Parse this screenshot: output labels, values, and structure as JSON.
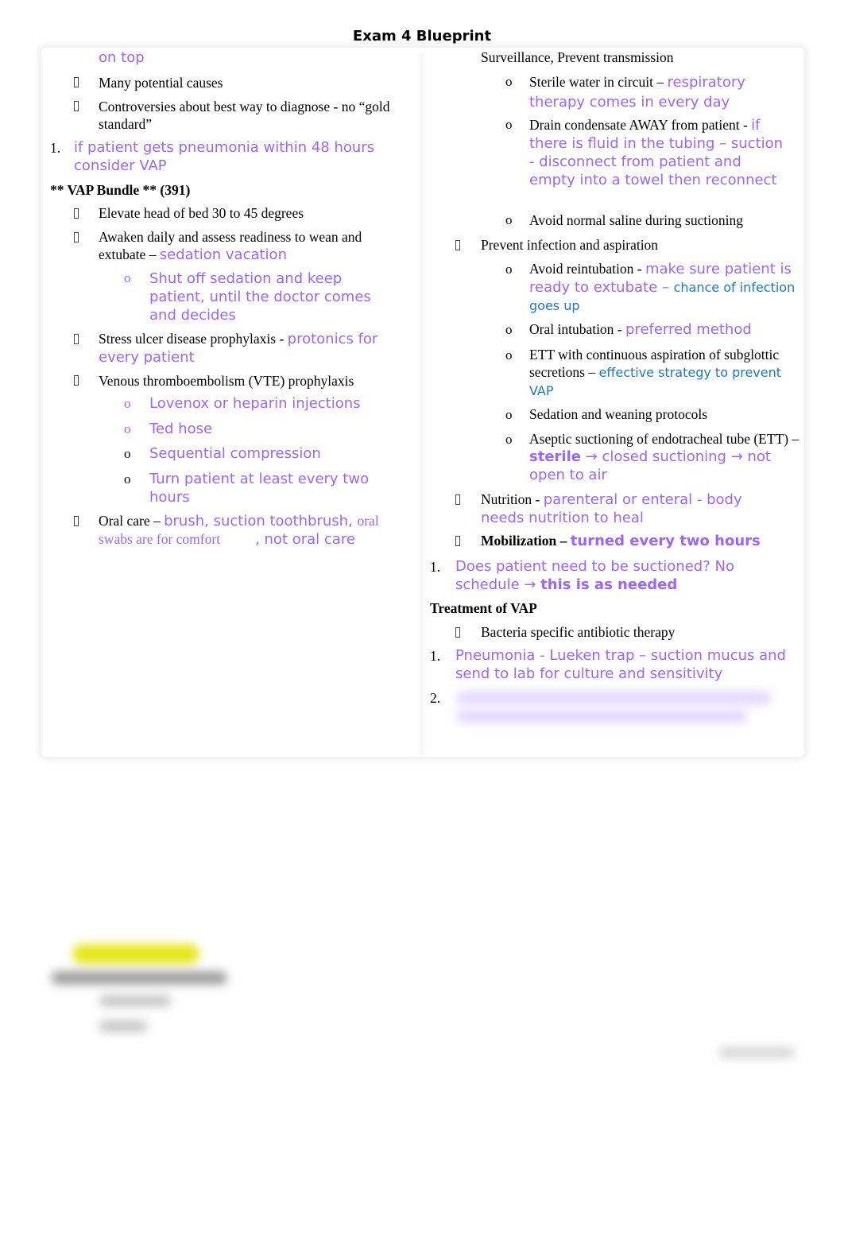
{
  "title": "Exam 4 Blueprint",
  "left": {
    "cont_top": "on top",
    "bullet1": "Many potential causes",
    "bullet2": "Controversies about best way to diagnose - no “gold standard”",
    "num1_marker": "1.",
    "num1_text": "if patient gets pneumonia within 48 hours consider VAP",
    "vap_heading": "** VAP Bundle ** (391)",
    "b_elevate": "Elevate head of bed 30 to 45 degrees",
    "b_awaken": "Awaken daily and assess readiness to wean and extubate – ",
    "b_awaken_note": "sedation vacation",
    "sub_shutoff": "Shut off sedation and keep patient, until the doctor comes and decides",
    "b_stress": "Stress ulcer disease prophylaxis - ",
    "b_stress_note": "protonics for every patient",
    "b_vte": "Venous thromboembolism (VTE) prophylaxis",
    "vte_subs": [
      "Lovenox or heparin injections",
      "Ted hose",
      "Sequential compression",
      "Turn patient at least every two hours"
    ],
    "b_oral": "Oral care – ",
    "b_oral_note1": "brush, suction toothbrush, ",
    "b_oral_note2": "oral swabs are for comfort",
    "b_oral_note3": ", not oral care"
  },
  "right": {
    "cont_top": "Surveillance, Prevent transmission",
    "sub_sterile": "Sterile water in circuit – ",
    "sub_sterile_note": "respiratory therapy comes in every day",
    "sub_drain": "Drain condensate AWAY from patient - ",
    "sub_drain_note": "if there is fluid in the tubing – suction - disconnect from patient and empty into a towel then reconnect",
    "sub_saline": "Avoid normal saline during suctioning",
    "b_prevent": "Prevent infection and aspiration",
    "sub_reintub": "Avoid reintubation - ",
    "sub_reintub_note": "make sure patient is ready to extubate – ",
    "sub_reintub_note2": "chance of infection goes up",
    "sub_oral": "Oral intubation - ",
    "sub_oral_note": "preferred method",
    "sub_ett": "ETT with continuous aspiration of subglottic secretions – ",
    "sub_ett_note": "effective strategy to prevent VAP",
    "sub_sedation": "Sedation and weaning protocols",
    "sub_aseptic": "Aseptic suctioning of endotracheal tube (ETT) – ",
    "sub_aseptic_bold": "sterile",
    "sub_aseptic_note": " → closed suctioning → not open to air",
    "b_nutrition": "Nutrition - ",
    "b_nutrition_note": "parenteral or enteral - body needs nutrition to heal",
    "b_mobil": "Mobilization – ",
    "b_mobil_note": "turned every two hours",
    "num1_marker": "1.",
    "num1_text": "Does patient need to be suctioned? No schedule → ",
    "num1_bold": "this is as needed",
    "treat_heading": "Treatment of VAP",
    "b_bacteria": "Bacteria specific antibiotic therapy",
    "t1_marker": "1.",
    "t1_text": "Pneumonia - Lueken trap – suction mucus and send to lab for culture and sensitivity",
    "t2_marker": "2."
  },
  "icons": {
    "bullet": "missing-glyph-box",
    "sub_bullet": "o"
  },
  "colors": {
    "purple": "#9966ff",
    "blue": "#1f77c4",
    "highlight": "#e6e619"
  }
}
